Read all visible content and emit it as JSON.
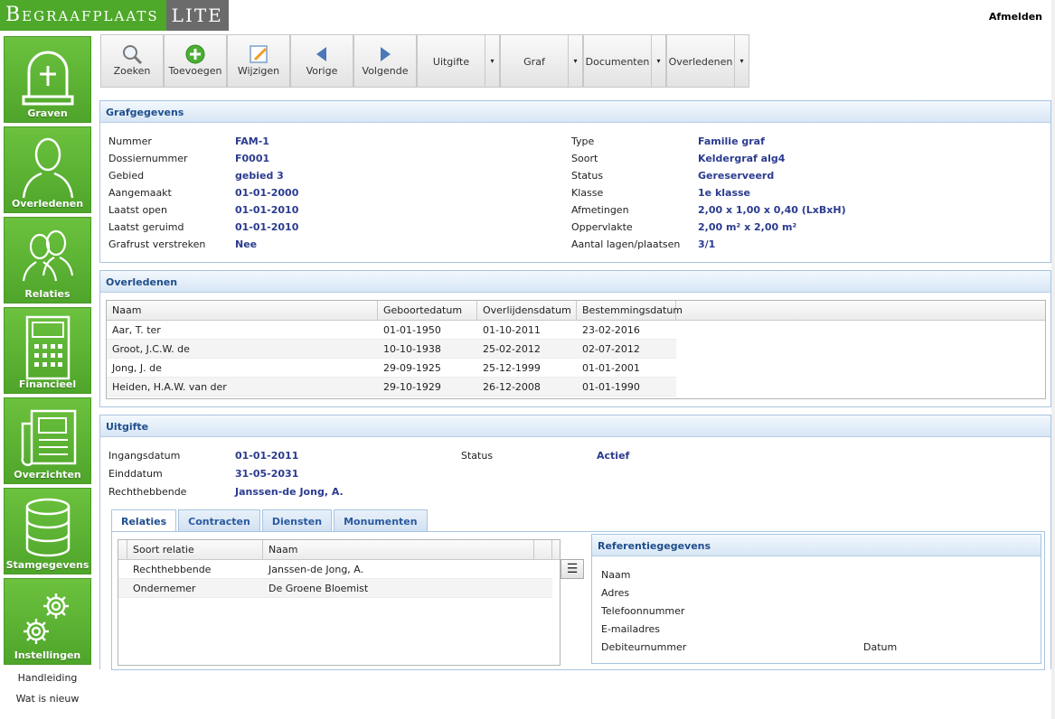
{
  "app": {
    "logo_main": "Begraafplaats",
    "logo_lite": "LITE",
    "logout": "Afmelden"
  },
  "sidebar": {
    "items": [
      {
        "label": "Graven",
        "icon": "grave-icon"
      },
      {
        "label": "Overledenen",
        "icon": "person-icon"
      },
      {
        "label": "Relaties",
        "icon": "people-icon"
      },
      {
        "label": "Financieel",
        "icon": "calculator-icon"
      },
      {
        "label": "Overzichten",
        "icon": "newspaper-icon"
      },
      {
        "label": "Stamgegevens",
        "icon": "database-icon"
      },
      {
        "label": "Instellingen",
        "icon": "gears-icon"
      }
    ],
    "links": [
      "Handleiding",
      "Wat is nieuw"
    ]
  },
  "toolbar": {
    "buttons": [
      {
        "label": "Zoeken",
        "icon": "magnifier-icon"
      },
      {
        "label": "Toevoegen",
        "icon": "add-icon"
      },
      {
        "label": "Wijzigen",
        "icon": "edit-icon"
      },
      {
        "label": "Vorige",
        "icon": "arrow-left-icon"
      },
      {
        "label": "Volgende",
        "icon": "arrow-right-icon"
      }
    ],
    "dropdowns": [
      "Uitgifte",
      "Graf",
      "Documenten",
      "Overledenen"
    ],
    "dropdown_arrow": "▾"
  },
  "grafgegevens": {
    "title": "Grafgegevens",
    "left": [
      {
        "label": "Nummer",
        "value": "FAM-1"
      },
      {
        "label": "Dossiernummer",
        "value": "F0001"
      },
      {
        "label": "Gebied",
        "value": "gebied 3"
      },
      {
        "label": "Aangemaakt",
        "value": "01-01-2000"
      },
      {
        "label": "Laatst open",
        "value": "01-01-2010"
      },
      {
        "label": "Laatst geruimd",
        "value": "01-01-2010"
      },
      {
        "label": "Grafrust verstreken",
        "value": "Nee"
      }
    ],
    "right": [
      {
        "label": "Type",
        "value": "Familie graf"
      },
      {
        "label": "Soort",
        "value": "Keldergraf alg4"
      },
      {
        "label": "Status",
        "value": "Gereserveerd"
      },
      {
        "label": "Klasse",
        "value": "1e klasse"
      },
      {
        "label": "Afmetingen",
        "value": "2,00 x 1,00 x 0,40 (LxBxH)"
      },
      {
        "label": "Oppervlakte",
        "value": "2,00 m² x 2,00 m²"
      },
      {
        "label": "Aantal lagen/plaatsen",
        "value": "3/1"
      }
    ]
  },
  "overledenen": {
    "title": "Overledenen",
    "columns": [
      "Naam",
      "Geboortedatum",
      "Overlijdensdatum",
      "Bestemmingsdatum"
    ],
    "rows": [
      [
        "Aar, T. ter",
        "01-01-1950",
        "01-10-2011",
        "23-02-2016"
      ],
      [
        "Groot, J.C.W. de",
        "10-10-1938",
        "25-02-2012",
        "02-07-2012"
      ],
      [
        "Jong, J. de",
        "29-09-1925",
        "25-12-1999",
        "01-01-2001"
      ],
      [
        "Heiden, H.A.W. van der",
        "29-10-1929",
        "26-12-2008",
        "01-01-1990"
      ]
    ]
  },
  "uitgifte": {
    "title": "Uitgifte",
    "fields": [
      {
        "label": "Ingangsdatum",
        "value": "01-01-2011"
      },
      {
        "label": "Einddatum",
        "value": "31-05-2031"
      },
      {
        "label": "Rechthebbende",
        "value": "Janssen-de Jong, A."
      }
    ],
    "status_label": "Status",
    "status_value": "Actief",
    "tabs": [
      "Relaties",
      "Contracten",
      "Diensten",
      "Monumenten"
    ],
    "relaties_columns": [
      "Soort relatie",
      "Naam"
    ],
    "relaties_rows": [
      [
        "Rechthebbende",
        "Janssen-de Jong, A."
      ],
      [
        "Ondernemer",
        "De Groene Bloemist"
      ]
    ],
    "menu_glyph": "☰",
    "referentie": {
      "title": "Referentiegegevens",
      "fields": [
        "Naam",
        "Adres",
        "Telefoonnummer",
        "E-mailadres",
        "Debiteurnummer"
      ],
      "datum_label": "Datum"
    }
  }
}
